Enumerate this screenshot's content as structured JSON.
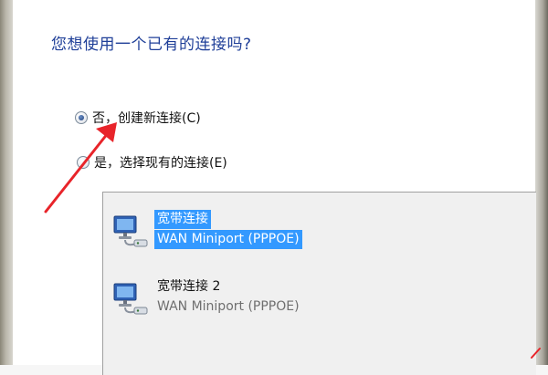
{
  "dialog": {
    "question": "您想使用一个已有的连接吗?"
  },
  "options": [
    {
      "label": "否，创建新连接(C)",
      "checked": true
    },
    {
      "label": "是，选择现有的连接(E)",
      "checked": false
    }
  ],
  "connections": [
    {
      "name": "宽带连接",
      "device": "WAN Miniport (PPPOE)",
      "selected": true,
      "icon": "network-connection-icon"
    },
    {
      "name": "宽带连接 2",
      "device": "WAN Miniport (PPPOE)",
      "selected": false,
      "icon": "network-connection-icon"
    }
  ],
  "colors": {
    "question": "#1f3f98",
    "selection": "#3399ff",
    "annotation": "#e8242a"
  }
}
